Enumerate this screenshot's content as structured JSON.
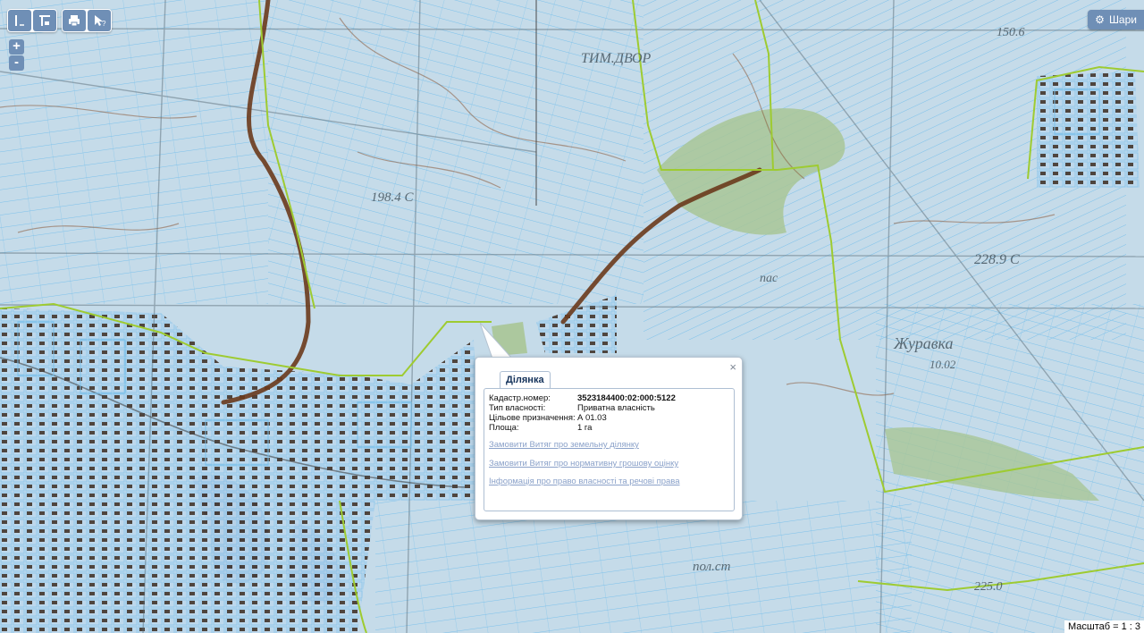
{
  "toolbar": {
    "buttons": [
      "ruler-icon",
      "area-measure-icon",
      "print-icon",
      "info-pointer-icon"
    ]
  },
  "zoom": {
    "in_label": "+",
    "out_label": "-"
  },
  "layers_button": {
    "label": "Шари"
  },
  "map_labels": {
    "tim_dvor": "ТИМ.ДВОР",
    "elev_198": "198.4 С",
    "pas": "пас",
    "elev_228": "228.9 С",
    "zhurivka": "Журавка",
    "zhurivka_num": "10.02",
    "pol_st": "пол.ст",
    "elev_225": "225.0",
    "elev_150": "150.6"
  },
  "popup": {
    "tab_label": "Ділянка",
    "close_label": "×",
    "fields": [
      {
        "label": "Кадастр.номер:",
        "value": "3523184400:02:000:5122",
        "bold": true
      },
      {
        "label": "Тип власності:",
        "value": "Приватна власність"
      },
      {
        "label": "Цільове призначення:",
        "value": "А 01.03"
      },
      {
        "label": "Площа:",
        "value": "1 га"
      }
    ],
    "links": [
      "Замовити Витяг про земельну ділянку",
      "Замовити Витяг про нормативну грошову оцінку",
      "Інформація про право власності та речові права"
    ]
  },
  "scale": {
    "label": "Масштаб = 1 : 3"
  },
  "colors": {
    "map_base": "#dfe4df",
    "parcel_fill": "#bcd8ec",
    "parcel_line": "#7cc1ea",
    "boundary_green": "#9ecb31",
    "road_brown": "#6a3a1c",
    "forest": "#a8c596",
    "water": "#8aa3cf",
    "settlement": "#3a2a20",
    "button": "#6f8fb6",
    "link": "#8aa1c9"
  }
}
